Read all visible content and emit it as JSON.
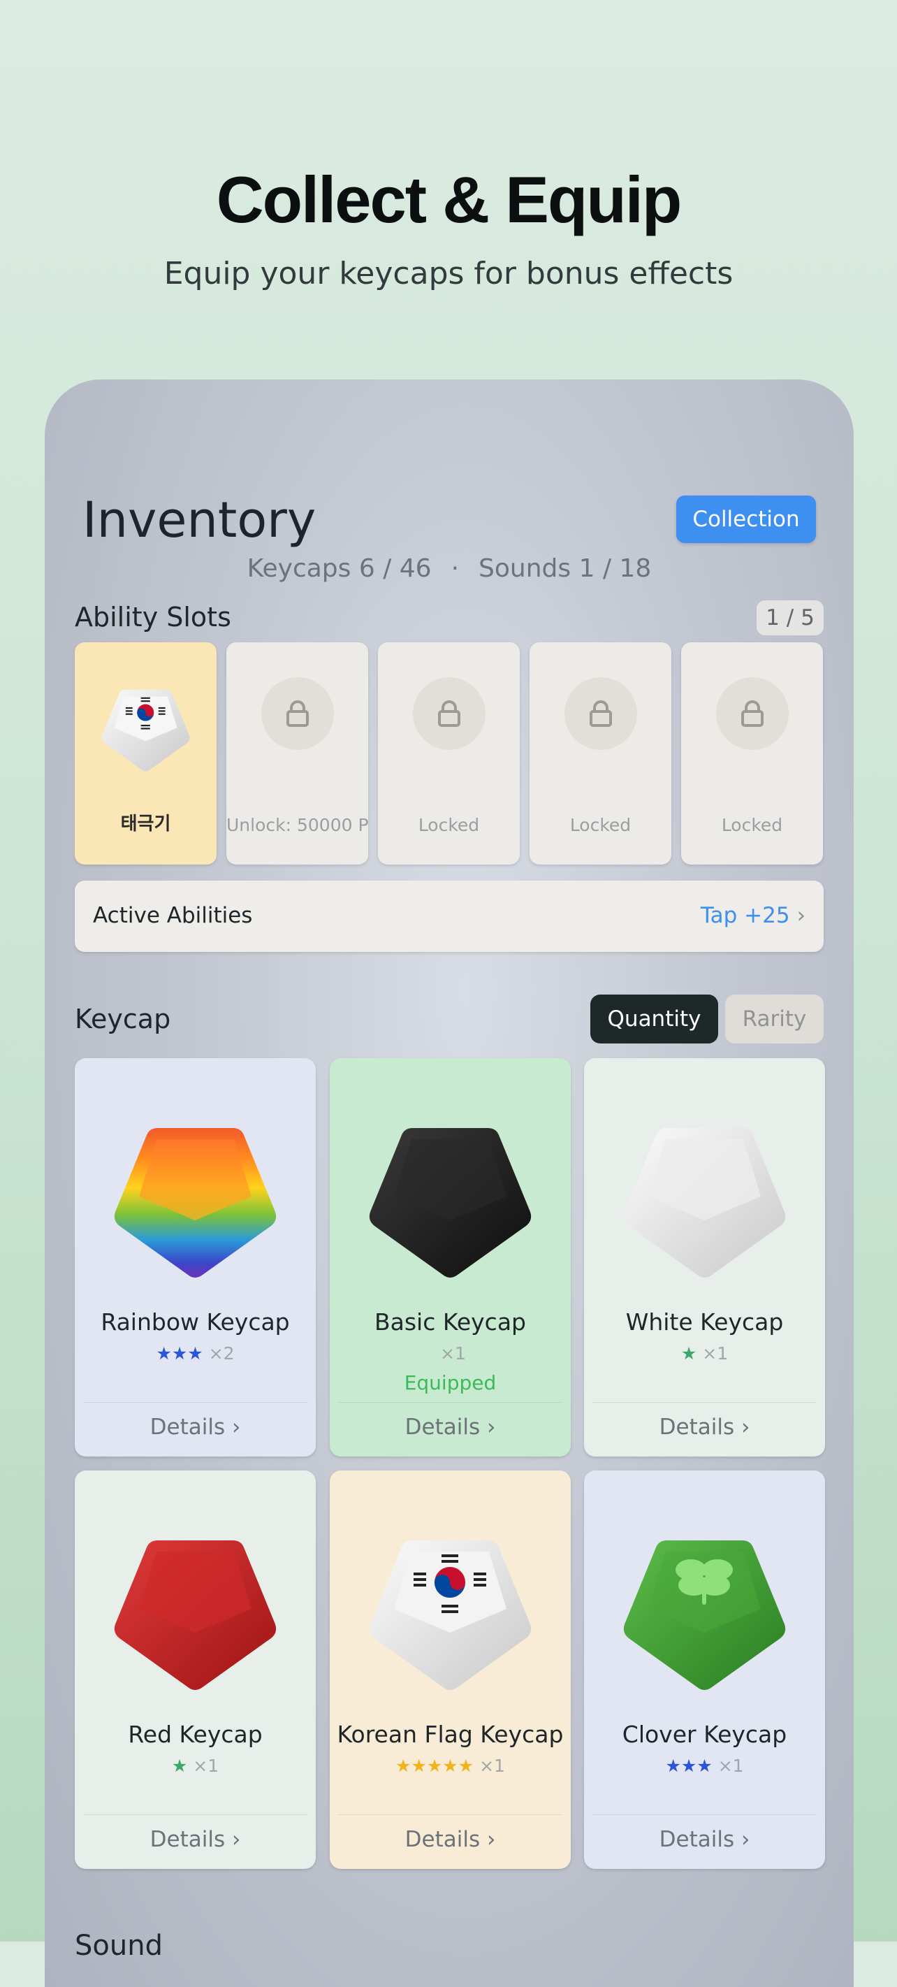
{
  "hero": {
    "title": "Collect & Equip",
    "subtitle": "Equip your keycaps for bonus effects"
  },
  "inventory": {
    "title": "Inventory",
    "collection_button": "Collection",
    "keycaps_count": "Keycaps 6 / 46",
    "separator": "·",
    "sounds_count": "Sounds 1 / 18"
  },
  "ability_slots": {
    "title": "Ability Slots",
    "badge": "1 / 5",
    "slots": [
      {
        "label": "태극기",
        "state": "equipped"
      },
      {
        "label": "Unlock: 50000 P",
        "state": "locked"
      },
      {
        "label": "Locked",
        "state": "locked"
      },
      {
        "label": "Locked",
        "state": "locked"
      },
      {
        "label": "Locked",
        "state": "locked"
      }
    ]
  },
  "active_abilities": {
    "label": "Active Abilities",
    "value": "Tap +25",
    "chevron": "›"
  },
  "keycap_section": {
    "title": "Keycap",
    "sort_options": [
      "Quantity",
      "Rarity"
    ],
    "selected_sort": "Quantity",
    "cards": [
      {
        "name": "Rainbow Keycap",
        "stars": "★★★",
        "star_color": "#2a55d8",
        "count": "×2",
        "status": "",
        "details": "Details  ›",
        "bg": "#e2e6f2",
        "cap": "rainbow"
      },
      {
        "name": "Basic Keycap",
        "stars": "",
        "star_color": "#2a55d8",
        "count": "×1",
        "status": "Equipped",
        "details": "Details  ›",
        "bg": "#c8ead0",
        "cap": "black"
      },
      {
        "name": "White Keycap",
        "stars": "★",
        "star_color": "#3aa86a",
        "count": "×1",
        "status": "",
        "details": "Details  ›",
        "bg": "#e8efea",
        "cap": "white"
      },
      {
        "name": "Red Keycap",
        "stars": "★",
        "star_color": "#3aa86a",
        "count": "×1",
        "status": "",
        "details": "Details  ›",
        "bg": "#e8efea",
        "cap": "red"
      },
      {
        "name": "Korean Flag Keycap",
        "stars": "★★★★★",
        "star_color": "#f2b21c",
        "count": "×1",
        "status": "",
        "details": "Details  ›",
        "bg": "#f8ecd6",
        "cap": "korea"
      },
      {
        "name": "Clover Keycap",
        "stars": "★★★",
        "star_color": "#2a55d8",
        "count": "×1",
        "status": "",
        "details": "Details  ›",
        "bg": "#e2e6f2",
        "cap": "clover"
      }
    ]
  },
  "next_section_title": "Sound"
}
